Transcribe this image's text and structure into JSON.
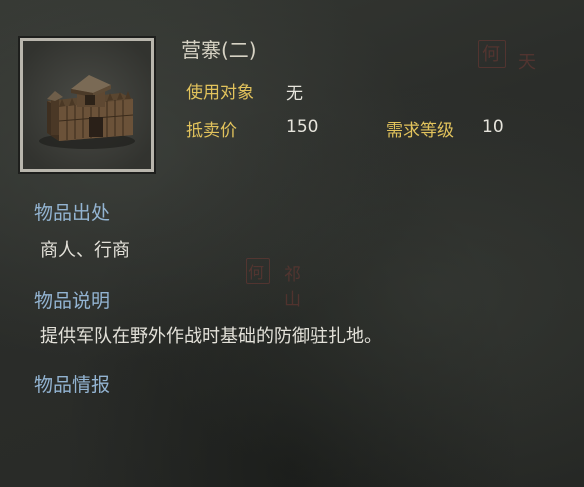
{
  "item": {
    "name": "营寨(二)",
    "target_label": "使用对象",
    "target_value": "无",
    "sell_label": "抵卖价",
    "sell_value": "150",
    "level_label": "需求等级",
    "level_value": "10"
  },
  "sections": {
    "origin_title": "物品出处",
    "origin_text": "商人、行商",
    "desc_title": "物品说明",
    "desc_text": "提供军队在野外作战时基础的防御驻扎地。",
    "intel_title": "物品情报"
  },
  "background_map": {
    "marks": [
      "何",
      "天",
      "何",
      "祁山"
    ]
  },
  "colors": {
    "title": "#d6d2c4",
    "label": "#e2c35c",
    "section": "#93b4d2",
    "frame": "#b9b6ad"
  }
}
